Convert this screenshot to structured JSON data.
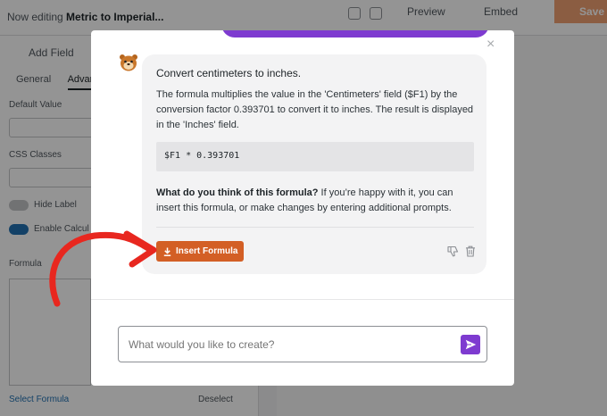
{
  "topbar": {
    "title_prefix": "Now editing",
    "title_form": "Metric to Imperial...",
    "preview_label": "Preview",
    "embed_label": "Embed",
    "save_label": "Save"
  },
  "left_panel": {
    "add_fields_label": "Add Field",
    "tabs": [
      "General",
      "Advan"
    ],
    "default_value_label": "Default Value",
    "css_classes_label": "CSS Classes",
    "hide_label": "Hide Label",
    "enable_calc_label": "Enable Calcul",
    "formula_label": "Formula",
    "formula_link": "Select Formula",
    "deselect_label": "Deselect"
  },
  "modal": {
    "close_glyph": "×",
    "message": {
      "title": "Convert centimeters to inches.",
      "description": "The formula multiplies the value in the 'Centimeters' field ($F1) by the conversion factor 0.393701 to convert it to inches. The result is displayed in the 'Inches' field.",
      "code": "$F1 * 0.393701",
      "question_bold": "What do you think of this formula?",
      "question_rest": " If you’re happy with it, you can insert this formula, or make changes by entering additional prompts.",
      "insert_button": "Insert Formula"
    },
    "prompt": {
      "placeholder": "What would you like to create?",
      "value": ""
    }
  },
  "colors": {
    "accent_purple": "#7e3bd0",
    "insert_orange": "#d35f25",
    "annotation_red": "#e8271f"
  },
  "icons": [
    "avatar-icon",
    "close-icon",
    "download-icon",
    "thumbs-down-icon",
    "trash-icon",
    "send-icon"
  ]
}
